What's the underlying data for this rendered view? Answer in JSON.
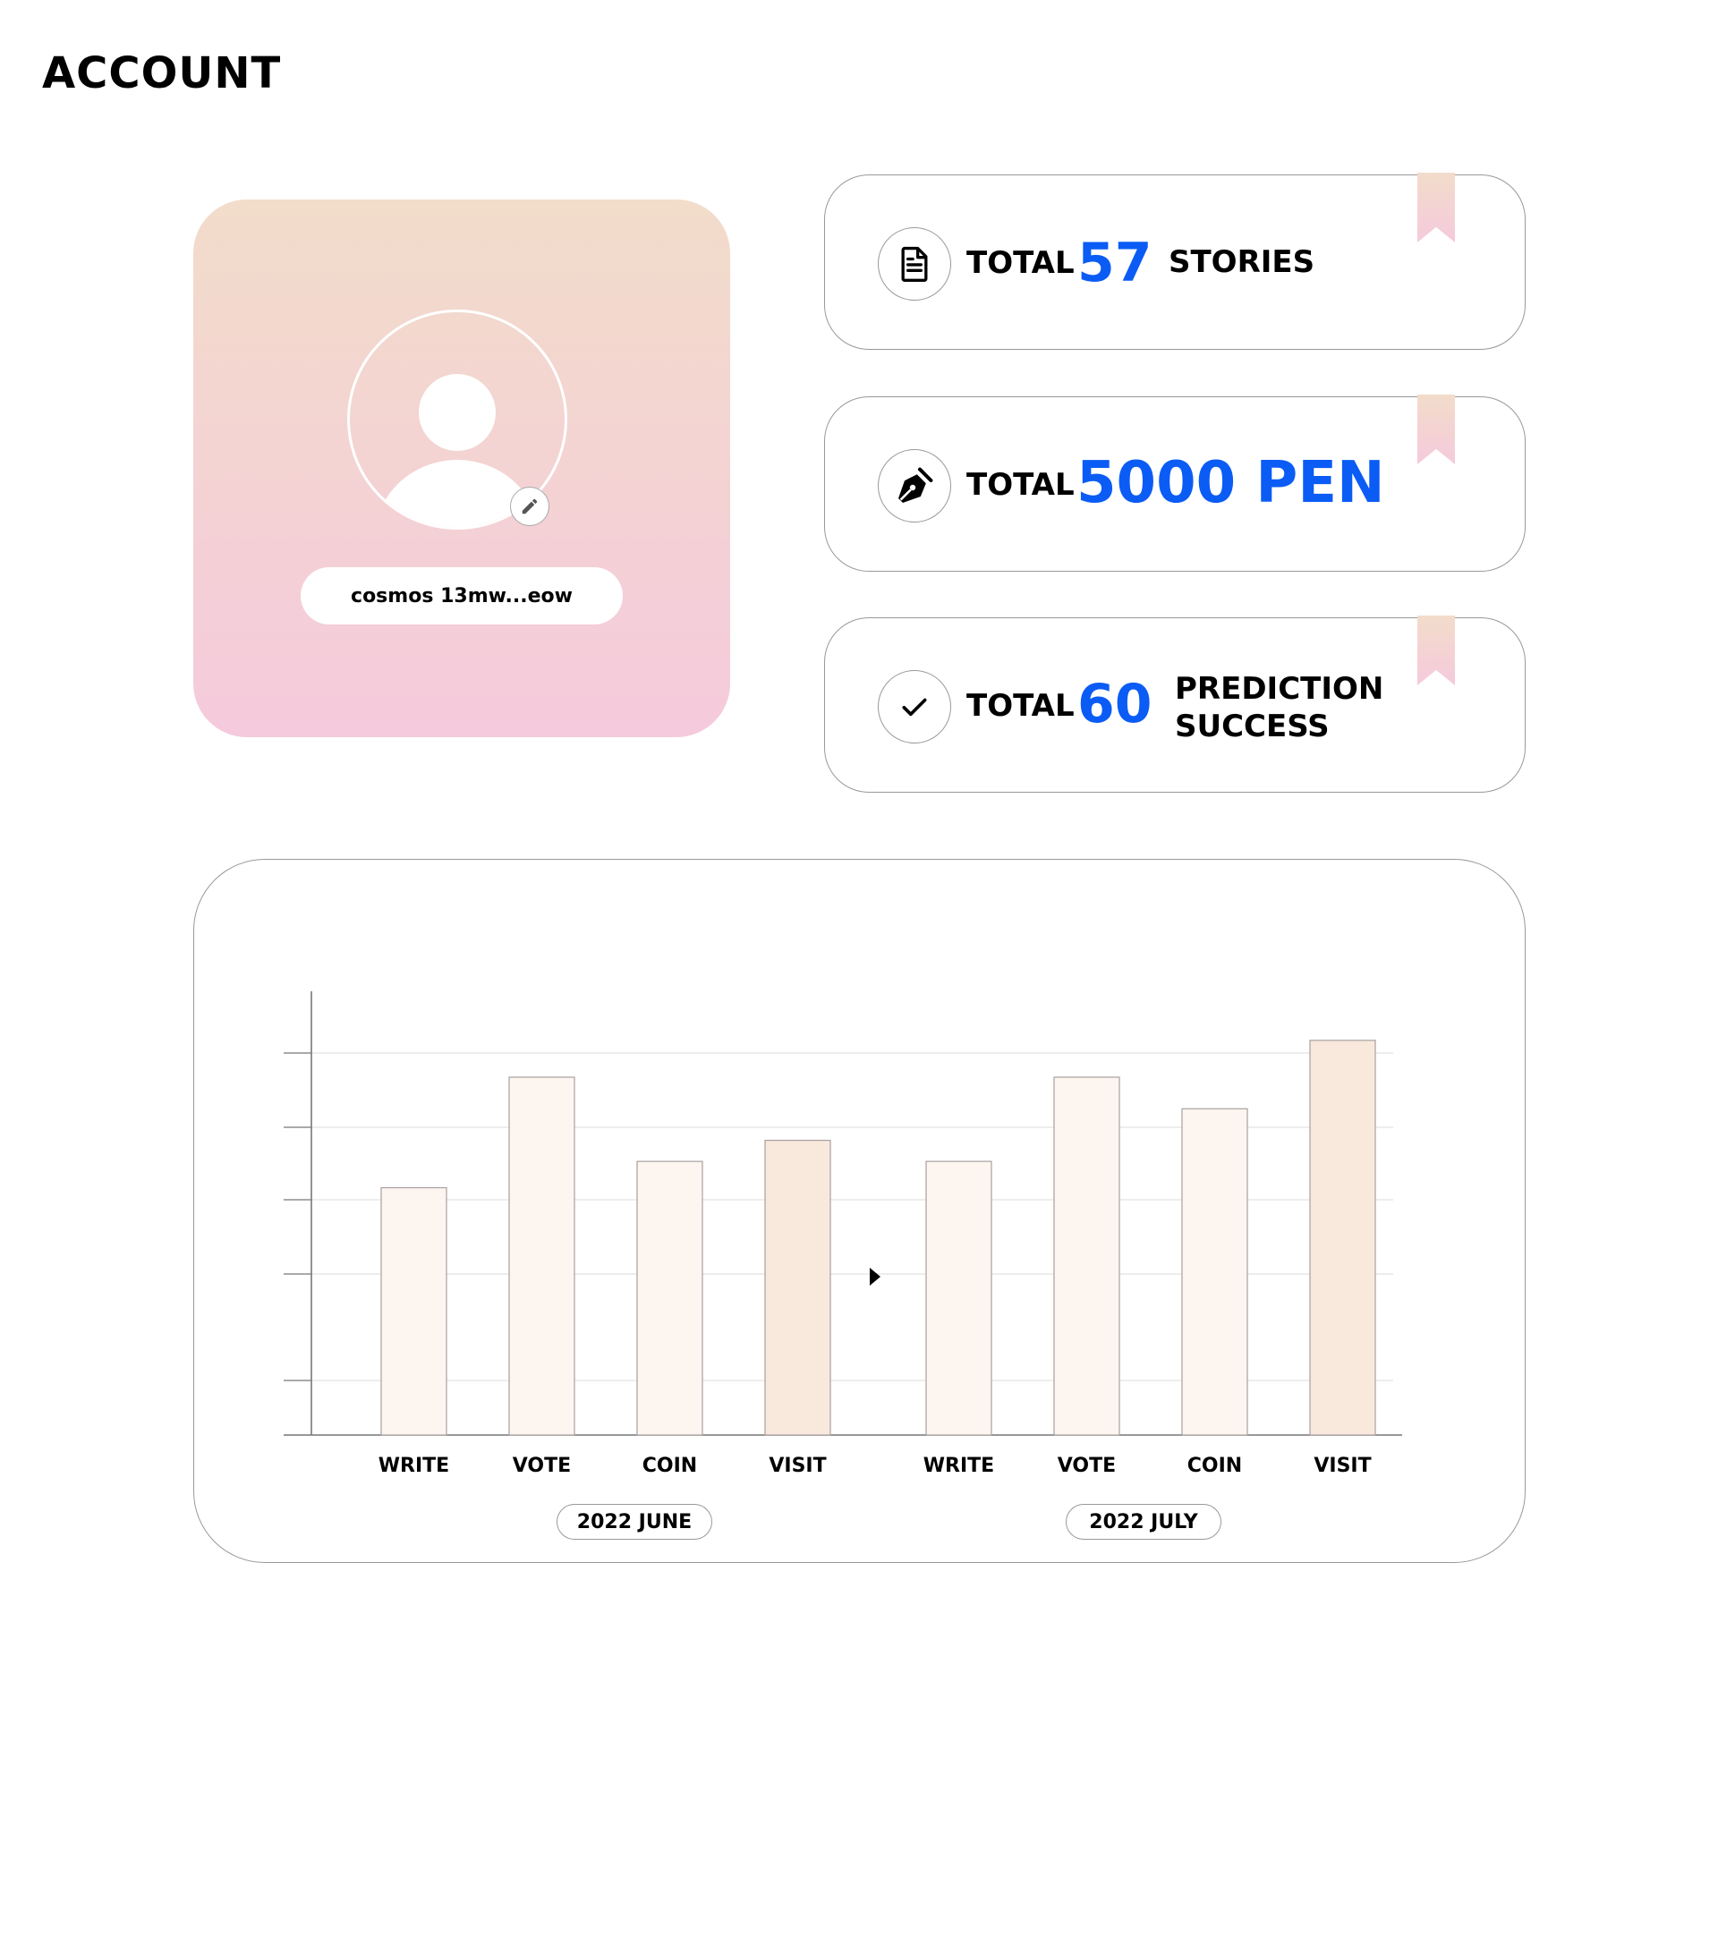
{
  "page": {
    "title": "ACCOUNT"
  },
  "profile": {
    "wallet_address": "cosmos 13mw...eow",
    "avatar_icon": "user-silhouette-icon",
    "edit_icon": "pencil-icon",
    "colors": {
      "gradient_top": "#f2dcca",
      "gradient_bottom": "#f5cadc"
    }
  },
  "stats": [
    {
      "icon": "document-icon",
      "total_label": "TOTAL",
      "value": "57",
      "unit": "STORIES"
    },
    {
      "icon": "pen-nib-icon",
      "total_label": "TOTAL",
      "value": "5000 PEN",
      "unit": ""
    },
    {
      "icon": "checkmark-icon",
      "total_label": "TOTAL",
      "value": "60",
      "unit_line1": "PREDICTION",
      "unit_line2": "SUCCESS"
    }
  ],
  "accent_color": "#0b5cf5",
  "chart_data": {
    "type": "bar",
    "groups": [
      {
        "label": "2022 JUNE",
        "categories": [
          "WRITE",
          "VOTE",
          "COIN",
          "VISIT"
        ],
        "values": [
          47,
          68,
          52,
          56
        ]
      },
      {
        "label": "2022 JULY",
        "categories": [
          "WRITE",
          "VOTE",
          "COIN",
          "VISIT"
        ],
        "values": [
          52,
          68,
          62,
          75
        ]
      }
    ],
    "ylim": [
      0,
      85
    ],
    "grid": true,
    "bar_colors": {
      "light": "#fdf5f0",
      "dark": "#f9e8dc"
    },
    "highlight_category": "VISIT",
    "navigation_icon": "play-arrow-icon"
  }
}
